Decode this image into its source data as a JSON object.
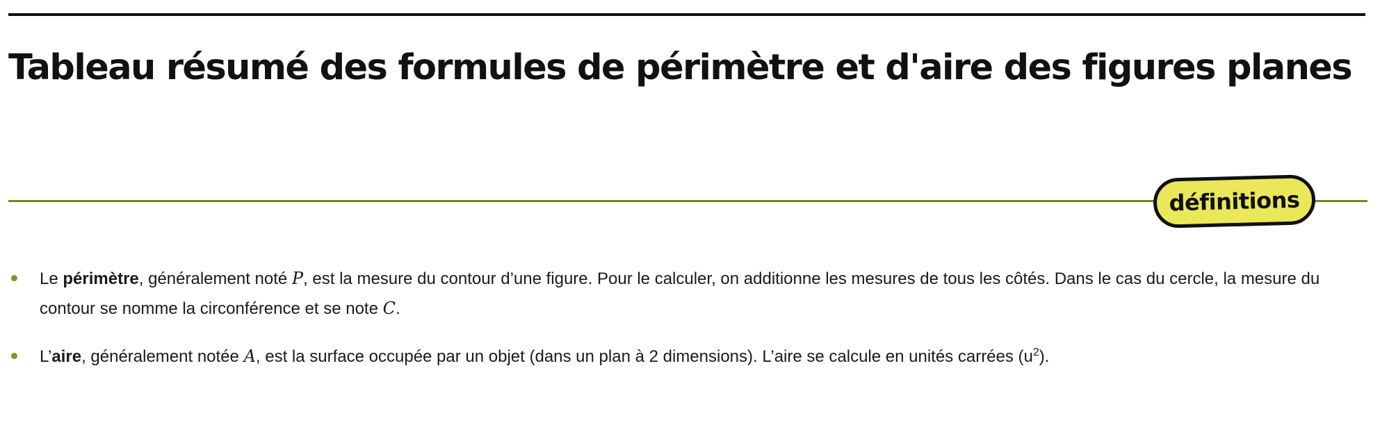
{
  "page": {
    "title": "Tableau résumé des formules de périmètre et d'aire des figures planes"
  },
  "section": {
    "badge_label": "définitions"
  },
  "definitions": [
    {
      "lead": "Le ",
      "term": "périmètre",
      "text_1": ", généralement noté ",
      "symbol_1": "P",
      "text_2": ", est la mesure du contour d’une figure. Pour le calculer, on additionne les mesures de tous les côtés. Dans le cas du cercle, la mesure du contour se nomme la circonférence et se note ",
      "symbol_2": "C",
      "text_3": "."
    },
    {
      "lead": "L’",
      "term": "aire",
      "text_1": ", généralement notée ",
      "symbol_1": "A",
      "text_2": ", est la surface occupée par un objet (dans un plan à 2 dimensions). L’aire se calcule en unités carrées (u",
      "superscript": "2",
      "text_3": ")."
    }
  ],
  "colors": {
    "accent_green": "#6b8c1a",
    "badge_yellow": "#eae75a",
    "rule_black": "#111111"
  }
}
